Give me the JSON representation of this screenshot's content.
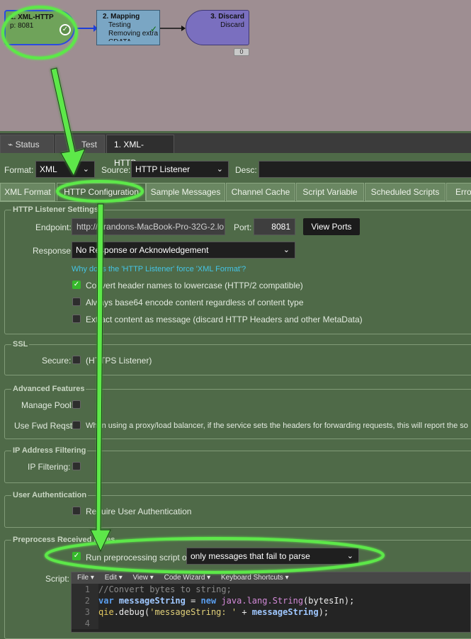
{
  "canvas": {
    "nodes": [
      {
        "title": "1. XML-HTTP",
        "sub": "p: 8081"
      },
      {
        "title": "2. Mapping",
        "sub1": "Testing",
        "sub2": "Removing extra",
        "sub3": "CDATA"
      },
      {
        "title": "3. Discard",
        "sub": "Discard"
      }
    ],
    "count_badge": "0"
  },
  "tabs": {
    "status": "Status",
    "test": "Test",
    "active": "1. XML-HTTP",
    "close": "×"
  },
  "format_row": {
    "format_label": "Format:",
    "format_value": "XML",
    "source_label": "Source:",
    "source_value": "HTTP Listener",
    "desc_label": "Desc:"
  },
  "subtabs": [
    "XML Format",
    "HTTP Configuration",
    "Sample Messages",
    "Channel Cache",
    "Script Variable",
    "Scheduled Scripts",
    "Erro"
  ],
  "http_listener": {
    "title": "HTTP Listener Settings",
    "endpoint_label": "Endpoint:",
    "endpoint_value": "http://Brandons-MacBook-Pro-32G-2.lo",
    "port_label": "Port:",
    "port_value": "8081",
    "view_ports": "View Ports",
    "response_label": "Response:",
    "response_value": "No Response or Acknowledgement",
    "why_link": "Why does the 'HTTP Listener' force 'XML Format'?",
    "opt1": "Convert header names to lowercase (HTTP/2 compatible)",
    "opt2": "Always base64 encode content regardless of content type",
    "opt3": "Extract content as message (discard HTTP Headers and other MetaData)"
  },
  "ssl": {
    "title": "SSL",
    "secure_label": "Secure:",
    "secure_text": "(HTTPS Listener)"
  },
  "advanced": {
    "title": "Advanced Features",
    "manage_pool": "Manage Pool:",
    "fwd_label": "Use Fwd Reqst:",
    "fwd_text": "When using a proxy/load balancer, if the service sets the headers for forwarding requests, this will report the so"
  },
  "ip": {
    "title": "IP Address Filtering",
    "label": "IP Filtering:"
  },
  "user_auth": {
    "title": "User Authentication",
    "label": "Require User Authentication"
  },
  "preprocess": {
    "title": "Preprocess Received Bytes",
    "run_label": "Run preprocessing script on",
    "run_value": "only messages that fail to parse",
    "script_label": "Script:"
  },
  "editor": {
    "toolbar": [
      "File ▾",
      "Edit ▾",
      "View ▾",
      "Code Wizard ▾",
      "Keyboard Shortcuts ▾"
    ],
    "line_numbers": [
      "1",
      "2",
      "3",
      "4"
    ],
    "line1": "//Convert bytes to string;",
    "l2_kw1": "var",
    "l2_var": "messageString",
    "l2_eq": " = ",
    "l2_new": "new",
    "l2_type": "java.lang.String",
    "l2_rest": "(bytesIn);",
    "l3_obj": "qie",
    "l3_fn": ".debug(",
    "l3_str": "'messageString: '",
    "l3_plus": " + ",
    "l3_var": "messageString",
    "l3_end": ");"
  },
  "colors": {
    "highlight": "#5de84a",
    "panel": "#4f6a48",
    "link": "#44c4e6"
  }
}
